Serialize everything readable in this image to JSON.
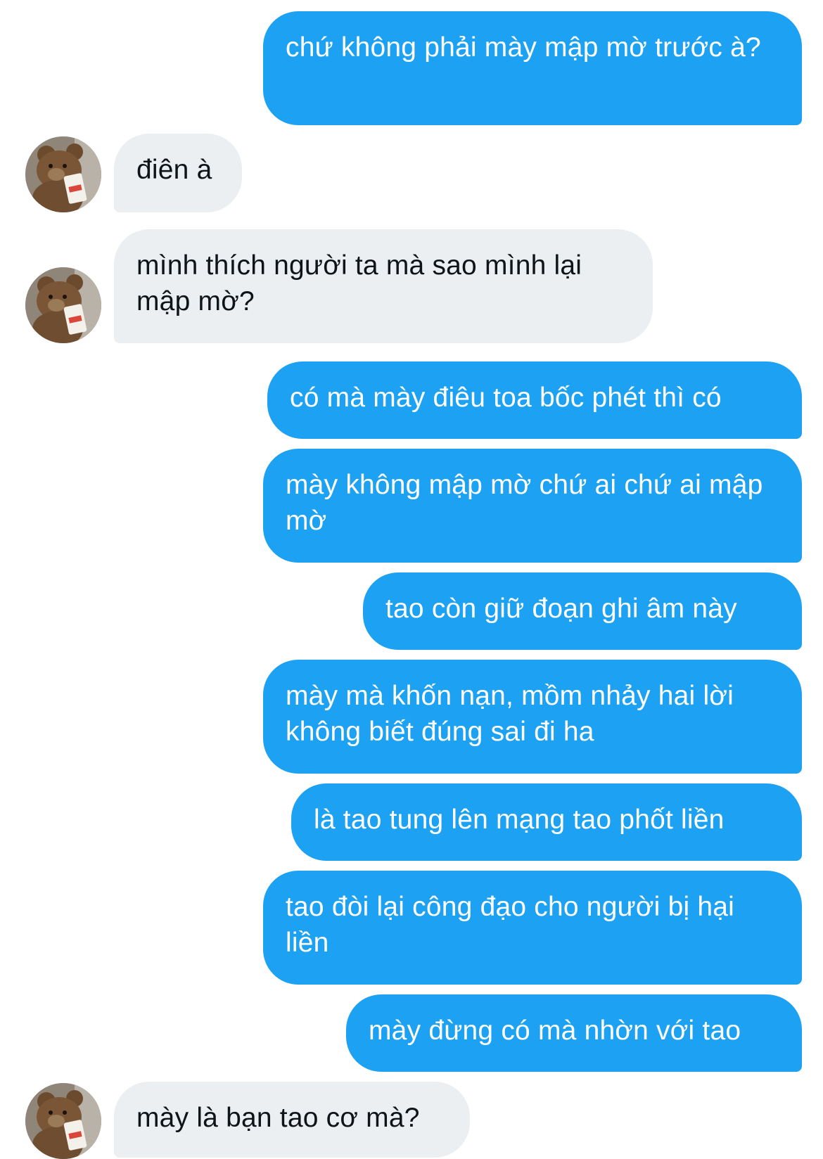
{
  "conversation": {
    "messages": [
      {
        "direction": "sent",
        "text": "chứ không phải mày mập mờ trước à?"
      },
      {
        "direction": "received",
        "text": "điên à"
      },
      {
        "direction": "received",
        "text": "mình thích người ta mà sao mình lại mập mờ?"
      },
      {
        "direction": "sent",
        "text": "có mà mày điêu toa bốc phét thì có"
      },
      {
        "direction": "sent",
        "text": "mày không mập mờ chứ ai chứ ai mập mờ"
      },
      {
        "direction": "sent",
        "text": "tao còn giữ đoạn ghi âm này"
      },
      {
        "direction": "sent",
        "text": "mày mà khốn nạn, mồm nhảy hai lời không biết đúng sai đi ha"
      },
      {
        "direction": "sent",
        "text": "là tao tung lên mạng tao phốt liền"
      },
      {
        "direction": "sent",
        "text": "tao đòi lại công đạo cho người bị hại liền"
      },
      {
        "direction": "sent",
        "text": "mày đừng có mà nhờn với tao"
      },
      {
        "direction": "received",
        "text": "mày là bạn tao cơ mà?"
      }
    ]
  },
  "avatar": {
    "icon": "teddy-bear-avatar-icon"
  },
  "colors": {
    "sent_bubble": "#1da1f2",
    "received_bubble": "#eceff1",
    "received_text": "#0f1419"
  }
}
